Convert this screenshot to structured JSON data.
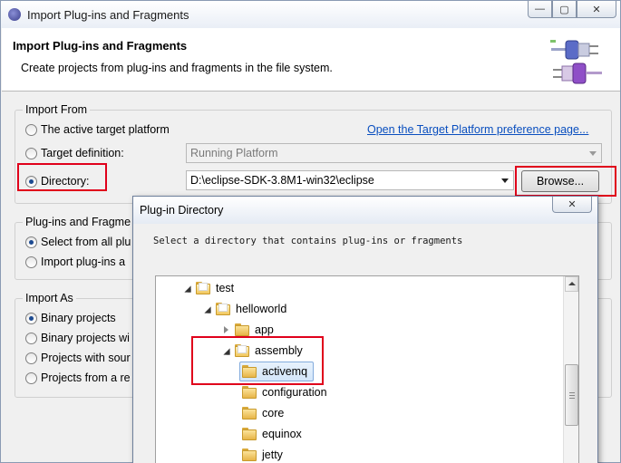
{
  "window": {
    "title": "Import Plug-ins and Fragments",
    "controls": {
      "minimize": "—",
      "maximize": "▢",
      "close": "✕"
    }
  },
  "header": {
    "title": "Import Plug-ins and Fragments",
    "description": "Create projects from plug-ins and fragments in the file system."
  },
  "import_from": {
    "label": "Import From",
    "active_target_label": "The active target platform",
    "preference_link": "Open the Target Platform preference page...",
    "target_definition_label": "Target definition:",
    "target_definition_value": "Running Platform",
    "directory_label": "Directory:",
    "directory_value": "D:\\eclipse-SDK-3.8M1-win32\\eclipse",
    "browse_label": "Browse...",
    "selected": "directory"
  },
  "plugins_group": {
    "label": "Plug-ins and Fragme",
    "option_select_all": "Select from all plu",
    "option_import": "Import plug-ins a"
  },
  "import_as": {
    "label": "Import As",
    "option_binary": "Binary projects",
    "option_binary_with": "Binary projects wi",
    "option_projects_source": "Projects with sour",
    "option_projects_from": "Projects from a re",
    "selected": "binary"
  },
  "dialog": {
    "title": "Plug-in Directory",
    "close": "✕",
    "message": "Select a directory that contains plug-ins or fragments",
    "tree": [
      {
        "label": "test",
        "expanded": true
      },
      {
        "label": "helloworld",
        "expanded": true
      },
      {
        "label": "app",
        "expanded": false
      },
      {
        "label": "assembly",
        "expanded": true
      },
      {
        "label": "activemq",
        "selected": true
      },
      {
        "label": "configuration"
      },
      {
        "label": "core"
      },
      {
        "label": "equinox"
      },
      {
        "label": "jetty"
      }
    ]
  },
  "colors": {
    "highlight_box": "#e0001b",
    "link": "#0a4fbf",
    "selection": "#d3e6fa"
  }
}
